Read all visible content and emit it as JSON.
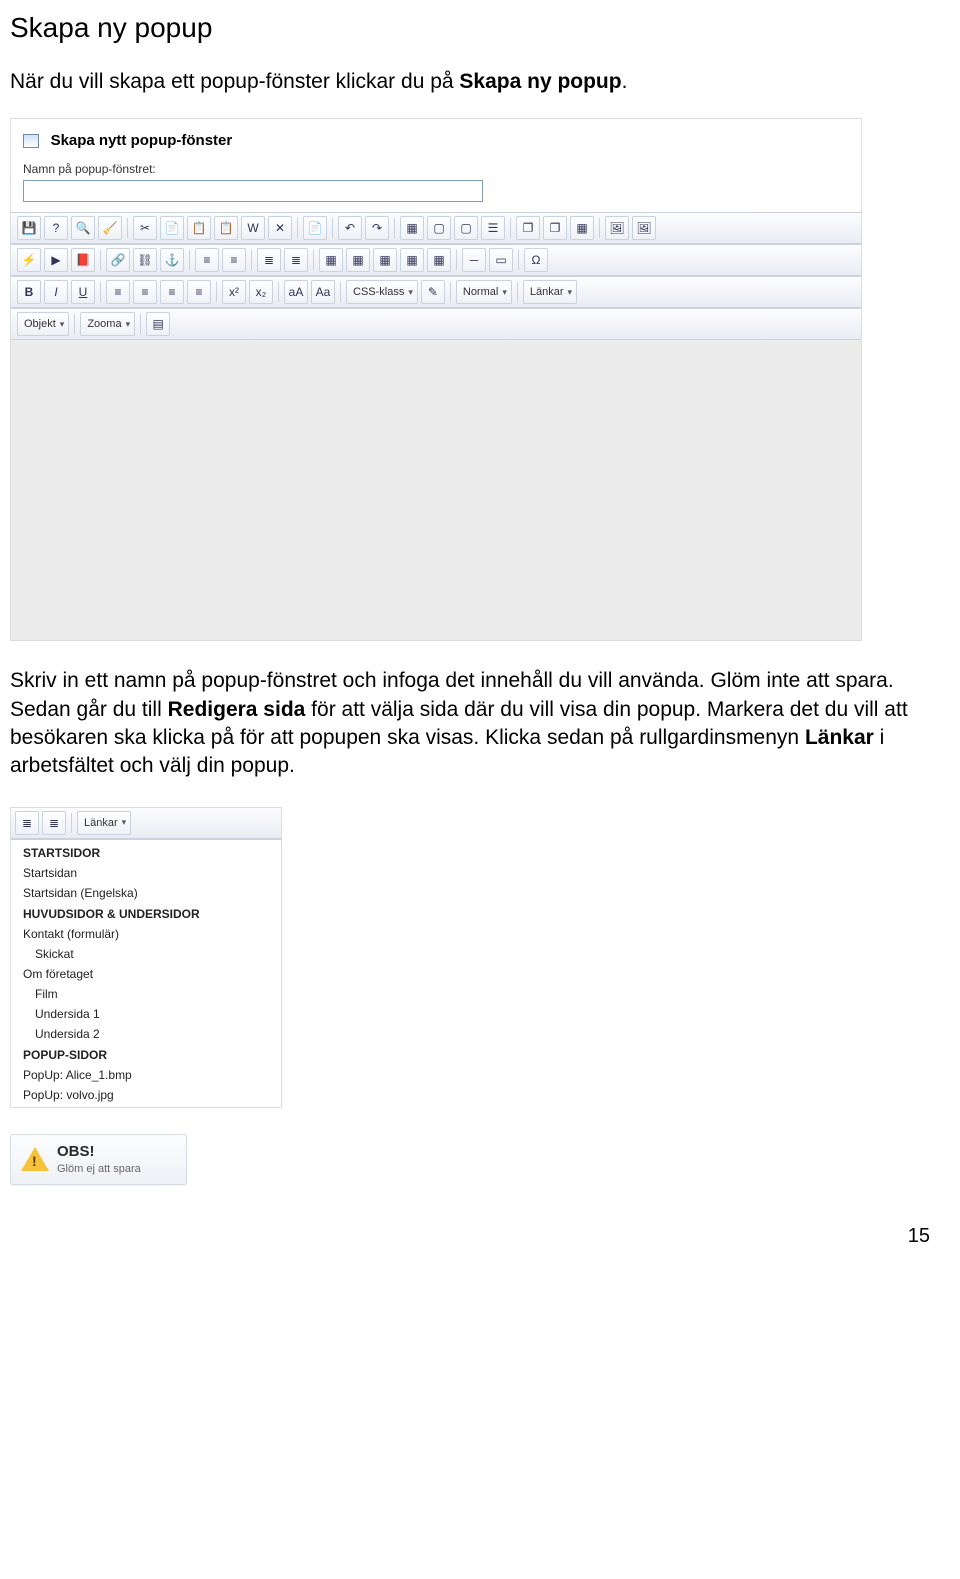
{
  "title": "Skapa ny popup",
  "intro_pre": "När du vill skapa ett popup-fönster klickar du på ",
  "intro_bold": "Skapa ny popup",
  "intro_post": ".",
  "editor": {
    "header_title": "Skapa nytt popup-fönster",
    "name_label": "Namn på popup-fönstret:",
    "name_value": "",
    "combos": {
      "css": "CSS-klass",
      "normal": "Normal",
      "links": "Länkar",
      "object": "Objekt",
      "zoom": "Zooma"
    }
  },
  "body2_parts": [
    {
      "t": "Skriv in ett namn på popup-fönstret och infoga det innehåll du vill använda. Glöm inte att spara. Sedan går du till "
    },
    {
      "b": "Redigera sida"
    },
    {
      "t": " för att välja sida där du vill visa din popup. Markera det du vill att besökaren ska klicka på för att popupen ska visas. Klicka sedan på rullgardinsmenyn "
    },
    {
      "b": "Länkar"
    },
    {
      "t": " i arbetsfältet och välj din popup."
    }
  ],
  "links_combo": "Länkar",
  "links_menu": [
    {
      "label": "STARTSIDOR",
      "heading": true
    },
    {
      "label": "Startsidan"
    },
    {
      "label": "Startsidan (Engelska)"
    },
    {
      "label": "HUVUDSIDOR & UNDERSIDOR",
      "heading": true
    },
    {
      "label": "Kontakt (formulär)"
    },
    {
      "label": "Skickat",
      "indent": true
    },
    {
      "label": "Om företaget"
    },
    {
      "label": "Film",
      "indent": true
    },
    {
      "label": "Undersida 1",
      "indent": true
    },
    {
      "label": "Undersida 2",
      "indent": true
    },
    {
      "label": "POPUP-SIDOR",
      "heading": true
    },
    {
      "label": "PopUp: Alice_1.bmp"
    },
    {
      "label": "PopUp: volvo.jpg"
    }
  ],
  "obs": {
    "title": "OBS!",
    "sub": "Glöm ej att spara"
  },
  "page_num": "15"
}
